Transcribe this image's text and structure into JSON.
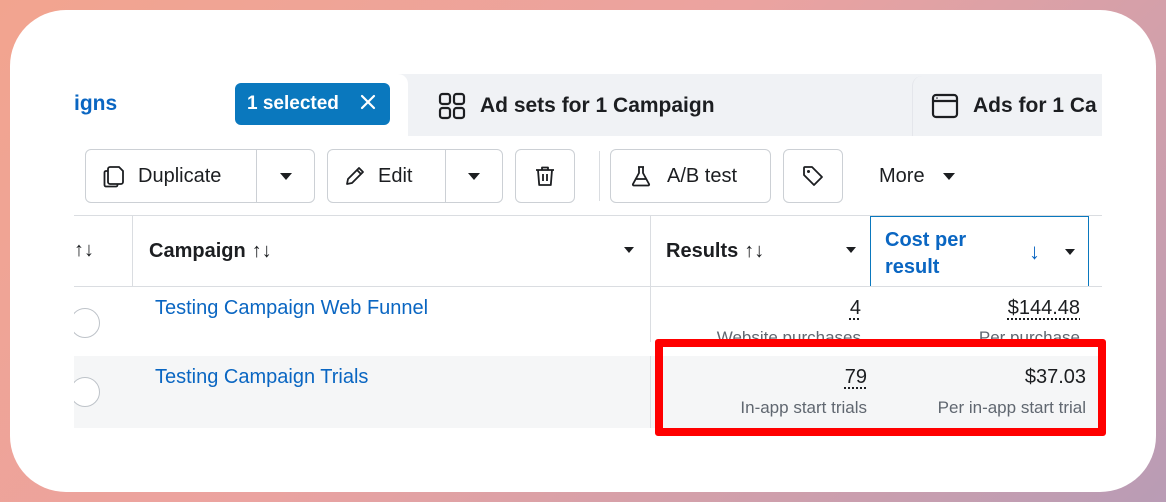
{
  "tabs": {
    "campaigns_label": "igns",
    "selected_label": "1 selected",
    "adsets_label": "Ad sets for 1 Campaign",
    "ads_label": "Ads for 1 Ca"
  },
  "toolbar": {
    "duplicate_label": "Duplicate",
    "edit_label": "Edit",
    "ab_test_label": "A/B test",
    "more_label": "More"
  },
  "table": {
    "headers": {
      "sort_glyph": "↑↓",
      "campaign": "Campaign",
      "results": "Results",
      "cost_per_result": "Cost per result",
      "sort_desc": "↓"
    },
    "rows": [
      {
        "campaign": "Testing Campaign Web Funnel",
        "results": "4",
        "results_sub": "Website purchases",
        "cost": "$144.48",
        "cost_sub": "Per purchase"
      },
      {
        "campaign": "Testing Campaign Trials",
        "results": "79",
        "results_sub": "In-app start trials",
        "cost": "$37.03",
        "cost_sub": "Per in-app start trial"
      }
    ]
  },
  "colors": {
    "accent": "#0a78be",
    "link": "#0a66c2",
    "highlight": "#ff0000"
  }
}
